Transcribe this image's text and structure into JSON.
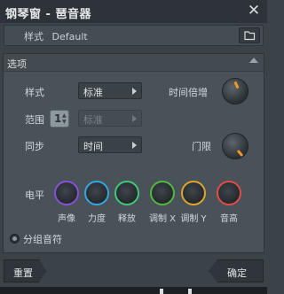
{
  "window": {
    "title": "钢琴窗 - 琶音器",
    "close_glyph": "✕"
  },
  "preset": {
    "label": "样式",
    "value": "Default",
    "folder_icon": "folder-icon"
  },
  "options": {
    "header": "选项",
    "style_label": "样式",
    "style_value": "标准",
    "range_label": "范围",
    "range_value": "1",
    "range_mode_value": "标准",
    "sync_label": "同步",
    "sync_value": "时间",
    "time_mult_label": "时间倍增",
    "gate_label": "门限",
    "level_label": "电平",
    "envelopes": [
      {
        "label": "声像",
        "color": "#8a4fd8"
      },
      {
        "label": "力度",
        "color": "#35a6e0"
      },
      {
        "label": "释放",
        "color": "#3fc878"
      },
      {
        "label": "调制 X",
        "color": "#52b93e"
      },
      {
        "label": "调制 Y",
        "color": "#e0a52a"
      },
      {
        "label": "音高",
        "color": "#e24b4b"
      }
    ],
    "group_notes_label": "分组音符"
  },
  "buttons": {
    "reset": "重置",
    "ok": "确定"
  }
}
